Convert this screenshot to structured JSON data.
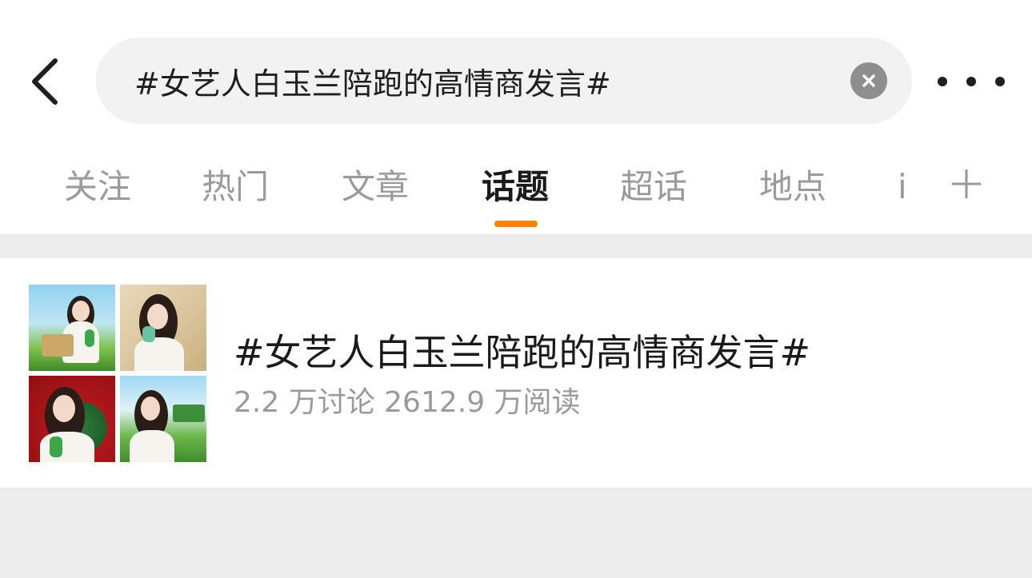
{
  "search": {
    "query": "#女艺人白玉兰陪跑的高情商发言#",
    "placeholder": ""
  },
  "tabs": [
    {
      "label": "关注",
      "active": false
    },
    {
      "label": "热门",
      "active": false
    },
    {
      "label": "文章",
      "active": false
    },
    {
      "label": "话题",
      "active": true
    },
    {
      "label": "超话",
      "active": false
    },
    {
      "label": "地点",
      "active": false
    }
  ],
  "tab_overflow_label": "i",
  "topic": {
    "title": "#女艺人白玉兰陪跑的高情商发言#",
    "stats": "2.2 万讨论 2612.9 万阅读"
  },
  "colors": {
    "accent": "#ff8200",
    "text_primary": "#1a1a1a",
    "text_secondary": "#9a9a9a",
    "search_bg": "#f2f2f2",
    "page_bg": "#ededed"
  },
  "icons": {
    "back": "chevron-left-icon",
    "clear": "clear-icon",
    "more": "more-icon",
    "add_tab": "plus-icon"
  }
}
